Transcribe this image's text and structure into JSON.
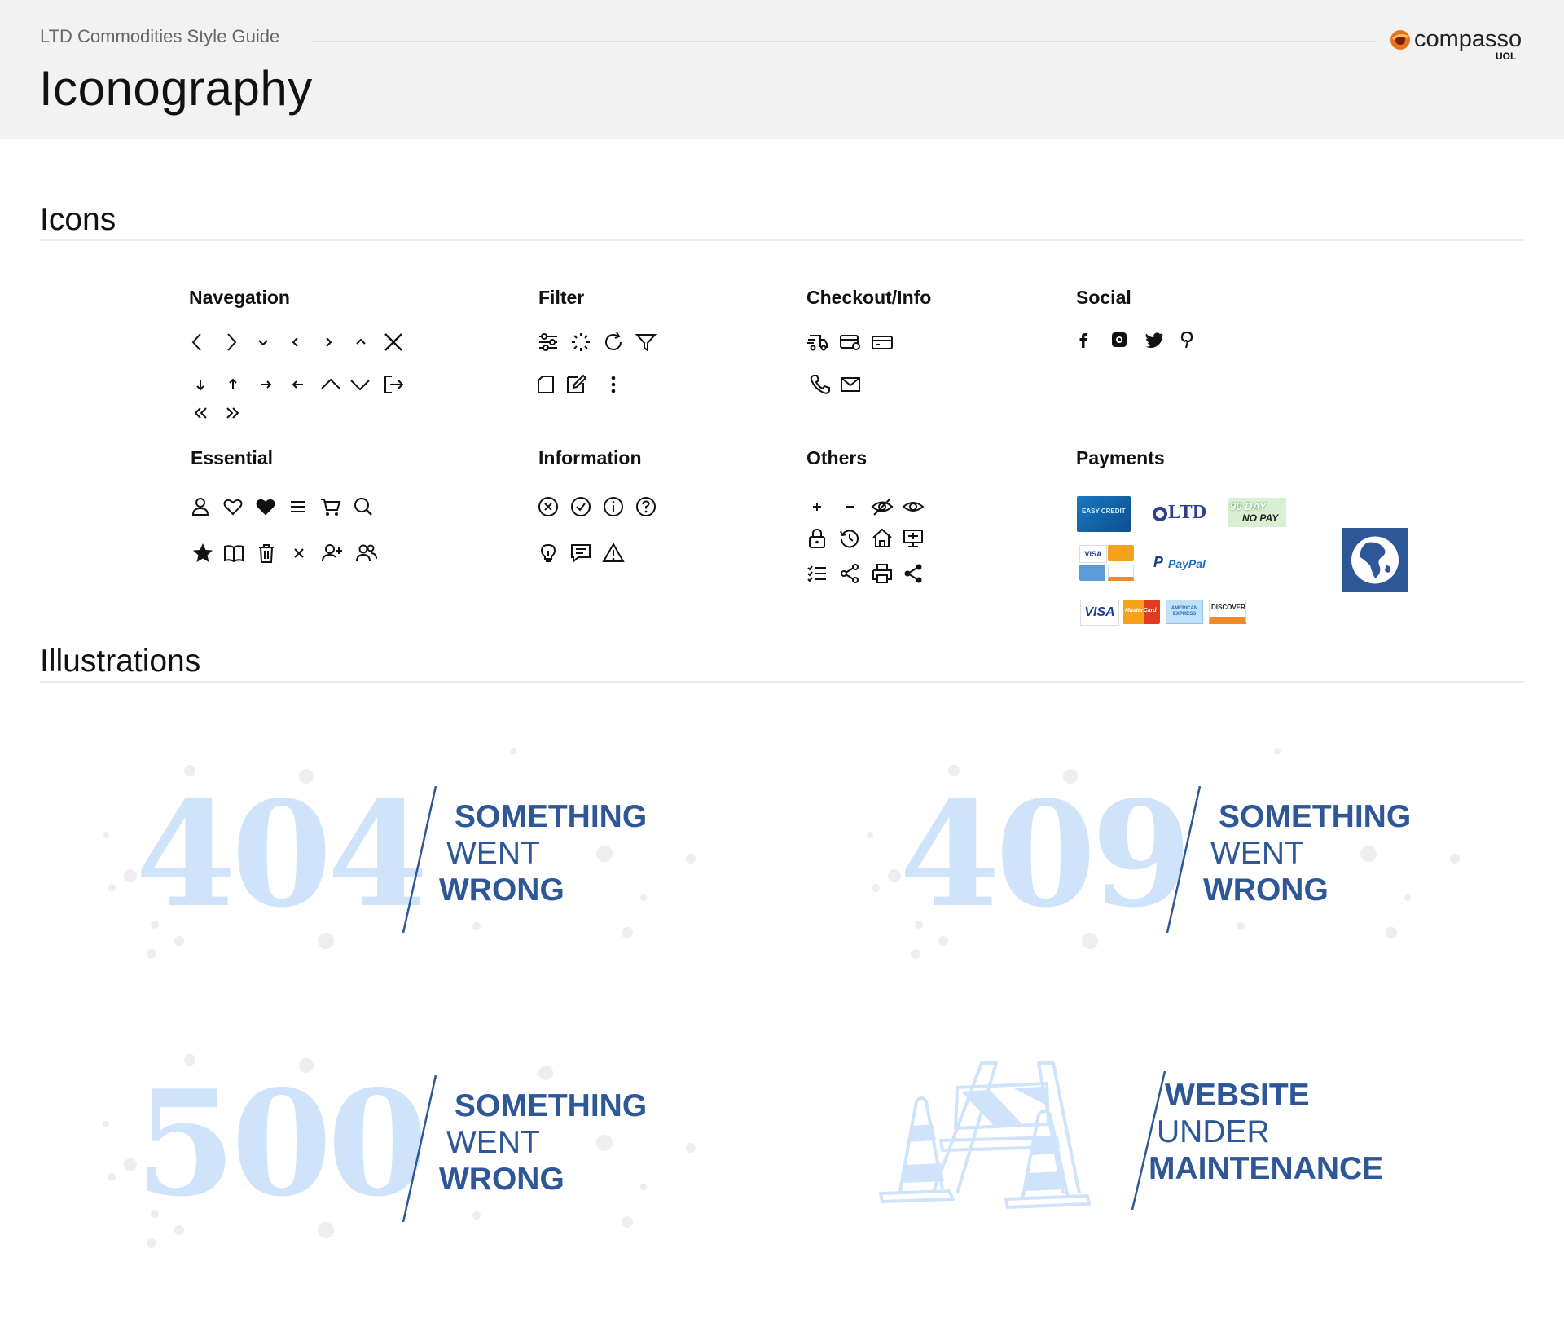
{
  "header": {
    "guide_title": "LTD Commodities Style Guide",
    "page_title": "Iconography",
    "logo_text": "compasso",
    "logo_sub": "UOL"
  },
  "sections": {
    "icons": "Icons",
    "illustrations": "Illustrations"
  },
  "groups": {
    "navegation": "Navegation",
    "filter": "Filter",
    "checkout": "Checkout/Info",
    "social": "Social",
    "essential": "Essential",
    "information": "Information",
    "others": "Others",
    "payments": "Payments"
  },
  "payments": {
    "easy_credit": "EASY CREDIT",
    "ltd_card": "LTD",
    "ninety_day_1": "90 DAY",
    "ninety_day_2": "NO PAY",
    "visa": "VISA",
    "paypal": "PayPal",
    "mastercard": "MasterCard",
    "amex": "AMERICAN EXPRESS",
    "discover": "DISCOVER"
  },
  "illustrations": {
    "e404": {
      "code": "404",
      "line1": "SOMETHING",
      "line2": "WENT",
      "line3": "WRONG"
    },
    "e409": {
      "code": "409",
      "line1": "SOMETHING",
      "line2": "WENT",
      "line3": "WRONG"
    },
    "e500": {
      "code": "500",
      "line1": "SOMETHING",
      "line2": "WENT",
      "line3": "WRONG"
    },
    "maint": {
      "line1": "WEBSITE",
      "line2": "UNDER",
      "line3": "MAINTENANCE"
    }
  },
  "colors": {
    "accent_blue": "#2e5797",
    "light_blue": "#cfe4fb",
    "header_bg": "#f2f2f2",
    "logo_orange": "#e8731c"
  }
}
